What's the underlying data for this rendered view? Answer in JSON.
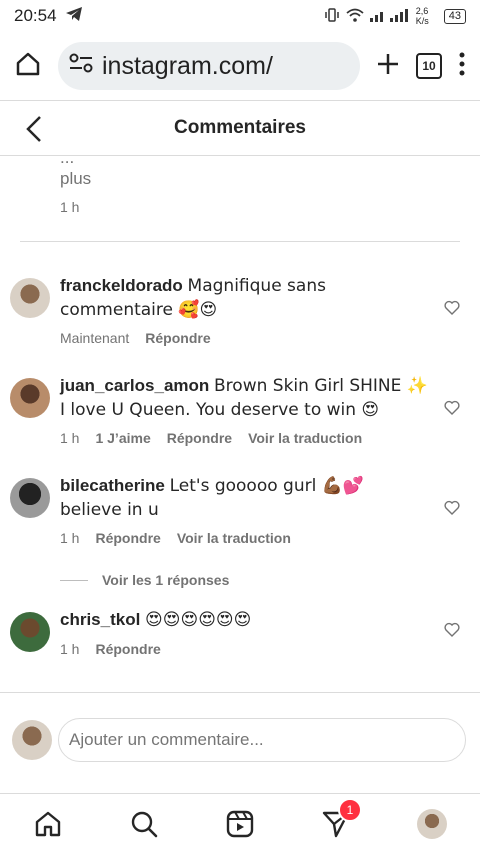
{
  "status": {
    "time": "20:54",
    "speed": "2,6 K/s",
    "battery": "43"
  },
  "browser": {
    "url": "instagram.com/",
    "tab_count": "10"
  },
  "header": {
    "title": "Commentaires"
  },
  "previous": {
    "ellipsis": "...",
    "more": "plus",
    "time": "1 h"
  },
  "comments": [
    {
      "user": "franckeldorado",
      "text": "Magnifique sans commentaire 🥰😍",
      "time": "Maintenant",
      "reply": "Répondre"
    },
    {
      "user": "juan_carlos_amon",
      "text": "Brown Skin Girl SHINE ✨ I love U Queen. You deserve to win 😍",
      "time": "1 h",
      "likes": "1 J’aime",
      "reply": "Répondre",
      "translate": "Voir la traduction"
    },
    {
      "user": "bilecatherine",
      "text": "Let's gooooo gurl 💪🏾💕 believe in u",
      "time": "1 h",
      "reply": "Répondre",
      "translate": "Voir la traduction",
      "view_replies": "Voir les 1 réponses"
    },
    {
      "user": "chris_tkol",
      "text": "😍😍😍😍😍😍",
      "time": "1 h",
      "reply": "Répondre"
    }
  ],
  "composer": {
    "placeholder": "Ajouter un commentaire..."
  },
  "tabbar": {
    "messages_badge": "1"
  }
}
